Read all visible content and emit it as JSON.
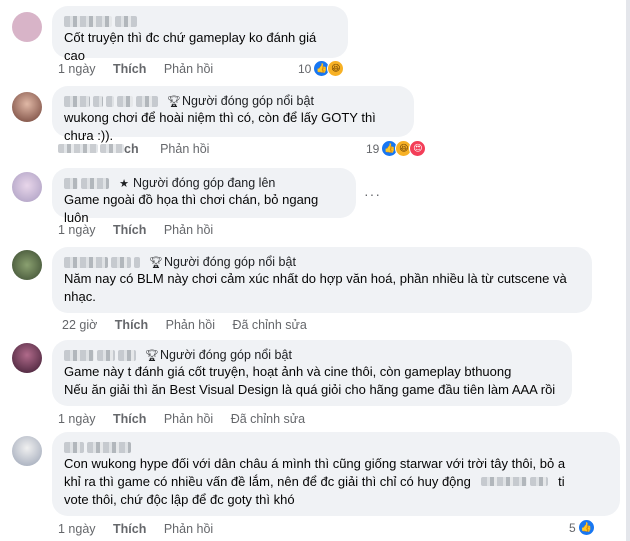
{
  "comments": [
    {
      "badge": "",
      "text": [
        "Cốt truyện thì đc chứ gameplay ko đánh giá cao"
      ],
      "time": "1 ngày",
      "like": "Thích",
      "reply": "Phản hồi",
      "edited": "",
      "react_count": "10",
      "reacts": [
        "like-icon",
        "haha-icon"
      ],
      "avatar_color": "#c9a3b7"
    },
    {
      "badge": "Người đóng góp nổi bật",
      "text": [
        "wukong chơi để hoài niệm thì có, còn để lấy GOTY thì chưa :))."
      ],
      "time": "",
      "like": "ch",
      "reply": "Phản hồi",
      "edited": "",
      "react_count": "19",
      "reacts": [
        "like-icon",
        "haha-icon",
        "love-icon"
      ],
      "avatar_color": "#8a5e55"
    },
    {
      "badge": "Người đóng góp đang lên",
      "text": [
        "Game ngoài đồ họa thì chơi chán, bỏ ngang luôn"
      ],
      "time": "1 ngày",
      "like": "Thích",
      "reply": "Phản hồi",
      "edited": "",
      "react_count": "",
      "reacts": [],
      "avatar_color": "#c3bdd6"
    },
    {
      "badge": "Người đóng góp nổi bật",
      "text": [
        "Năm nay có BLM này chơi cảm xúc nhất do hợp văn hoá, phần nhiều là từ cutscene và",
        "nhạc."
      ],
      "time": "22 giờ",
      "like": "Thích",
      "reply": "Phản hồi",
      "edited": "Đã chỉnh sửa",
      "react_count": "",
      "reacts": [],
      "avatar_color": "#4a5a3a"
    },
    {
      "badge": "Người đóng góp nổi bật",
      "text": [
        "Game này t đánh giá cốt truyện, hoạt ảnh và cine thôi, còn gameplay bthuong",
        "Nếu ăn giải thì ăn Best Visual Design là quá giỏi cho hãng game đầu tiên làm AAA rồi"
      ],
      "time": "1 ngày",
      "like": "Thích",
      "reply": "Phản hồi",
      "edited": "Đã chỉnh sửa",
      "react_count": "",
      "reacts": [],
      "avatar_color": "#5a2e4a"
    },
    {
      "badge": "",
      "text": [
        "Con wukong hype đối với dân châu á mình thì cũng giống starwar với trời tây thôi, bỏ a",
        "khỉ ra thì game có nhiều vấn đề lắm, nên để đc giải thì chỉ có huy động",
        "vote thôi, chứ độc lập để đc goty thì khó"
      ],
      "trail": "ti",
      "time": "1 ngày",
      "like": "Thích",
      "reply": "Phản hồi",
      "edited": "",
      "react_count": "5",
      "reacts": [
        "like-icon"
      ],
      "avatar_color": "#d8dce6"
    }
  ],
  "more_label": "···"
}
